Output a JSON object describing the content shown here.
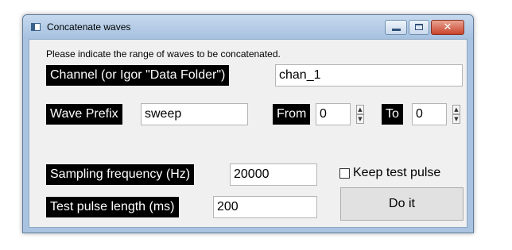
{
  "window": {
    "title": "Concatenate waves",
    "icons": {
      "app": "app-window-icon",
      "minimize": "minimize-icon",
      "maximize": "maximize-icon",
      "close": "close-icon"
    },
    "close_color": "#c9442c"
  },
  "form": {
    "instructions": "Please indicate the range of waves to be concatenated.",
    "channel": {
      "label": "Channel (or Igor \"Data Folder\")",
      "value": "chan_1"
    },
    "wave_prefix": {
      "label": "Wave Prefix",
      "value": "sweep"
    },
    "from": {
      "label": "From",
      "value": "0"
    },
    "to": {
      "label": "To",
      "value": "0"
    },
    "sampling_frequency": {
      "label": "Sampling frequency (Hz)",
      "value": "20000"
    },
    "test_pulse_length": {
      "label": "Test pulse length (ms)",
      "value": "200"
    },
    "keep_test_pulse": {
      "label": "Keep test pulse",
      "checked": false
    },
    "do_it_label": "Do it"
  }
}
